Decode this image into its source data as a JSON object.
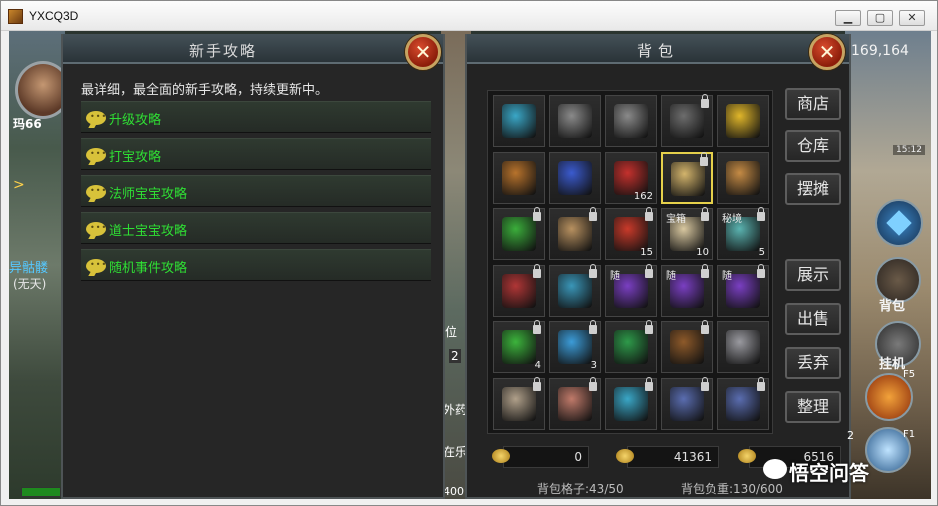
{
  "window": {
    "title": "YXCQ3D",
    "min": "▁",
    "max": "▢",
    "close": "✕"
  },
  "world": {
    "left_name": "玛66",
    "left_tag": "异骷髅",
    "left_tag2": "(无天)",
    "mid_tag1": "位",
    "mid_tag2": "2",
    "mid_tag3": "外药",
    "mid_tag4": "在乐",
    "mid_bottom": "400",
    "right_coins": "169,164",
    "right_time": "15:12",
    "bag_label": "背包",
    "hang_label": "挂机",
    "key_f5": "F5",
    "key_f1": "F1",
    "left_num": "2",
    "left_arrow": ">"
  },
  "guide": {
    "title": "新手攻略",
    "intro": "最详细，最全面的新手攻略，持续更新中。",
    "items": [
      "升级攻略",
      "打宝攻略",
      "法师宝宝攻略",
      "道士宝宝攻略",
      "随机事件攻略"
    ],
    "close": "✕"
  },
  "bag": {
    "title": "背包",
    "close": "✕",
    "side_buttons": [
      "商店",
      "仓库",
      "摆摊",
      "展示",
      "出售",
      "丢弃",
      "整理"
    ],
    "cells": [
      {
        "icon": "cloth-icon",
        "color": "#3aa7c7"
      },
      {
        "icon": "sword-icon",
        "color": "#8a8a8a"
      },
      {
        "icon": "sword-icon",
        "color": "#8a8a8a"
      },
      {
        "icon": "sword-icon",
        "color": "#6d6d6d",
        "lock": true
      },
      {
        "icon": "bottle-icon",
        "color": "#e0b62a"
      },
      {
        "icon": "helmet-icon",
        "color": "#b8732c"
      },
      {
        "icon": "scroll-orb-icon",
        "color": "#3b5bcf"
      },
      {
        "icon": "bag-icon",
        "color": "#c4312d",
        "count": "162"
      },
      {
        "icon": "scroll-icon",
        "color": "#d3b46c",
        "selected": true,
        "lock": true
      },
      {
        "icon": "book-icon",
        "color": "#c58b45"
      },
      {
        "icon": "pouch-icon",
        "color": "#3bae3b",
        "lock": true
      },
      {
        "icon": "scroll-icon",
        "color": "#b89160",
        "lock": true
      },
      {
        "icon": "cape-icon",
        "color": "#c93a2a",
        "count": "15",
        "lock": true
      },
      {
        "icon": "paper-icon",
        "color": "#d9c8a0",
        "tag": "宝箱",
        "count": "10",
        "lock": true
      },
      {
        "icon": "map-icon",
        "color": "#5ab3b0",
        "tag": "秘境",
        "count": "5",
        "lock": true
      },
      {
        "icon": "chest-icon",
        "color": "#b03636",
        "lock": true
      },
      {
        "icon": "chest-icon",
        "color": "#3a96b8",
        "lock": true
      },
      {
        "icon": "stick-icon",
        "color": "#7a3fc2",
        "tag": "随",
        "lock": true
      },
      {
        "icon": "stick-icon",
        "color": "#7a3fc2",
        "tag": "随",
        "lock": true
      },
      {
        "icon": "stick-icon",
        "color": "#7a3fc2",
        "tag": "随",
        "lock": true
      },
      {
        "icon": "crystal-icon",
        "color": "#3cb43c",
        "count": "4",
        "lock": true
      },
      {
        "icon": "crystal-icon",
        "color": "#3c9cd8",
        "count": "3",
        "lock": true
      },
      {
        "icon": "book-icon",
        "color": "#2e9a4a",
        "lock": true
      },
      {
        "icon": "treasure-chest-icon",
        "color": "#8e5a2a",
        "lock": true
      },
      {
        "icon": "sword-icon",
        "color": "#9a9aa0"
      },
      {
        "icon": "bow-icon",
        "color": "#b0a08a",
        "lock": true
      },
      {
        "icon": "glove-icon",
        "color": "#c07a6a",
        "lock": true
      },
      {
        "icon": "cloth-icon",
        "color": "#3aa7c7",
        "lock": true
      },
      {
        "icon": "armor-icon",
        "color": "#5a6db0",
        "lock": true
      },
      {
        "icon": "armor-icon",
        "color": "#5a6db0",
        "lock": true
      }
    ],
    "money": [
      "0",
      "41361",
      "6516"
    ],
    "slots_label": "背包格子:43/50",
    "weight_label": "背包负重:130/600"
  },
  "watermark": "悟空问答"
}
